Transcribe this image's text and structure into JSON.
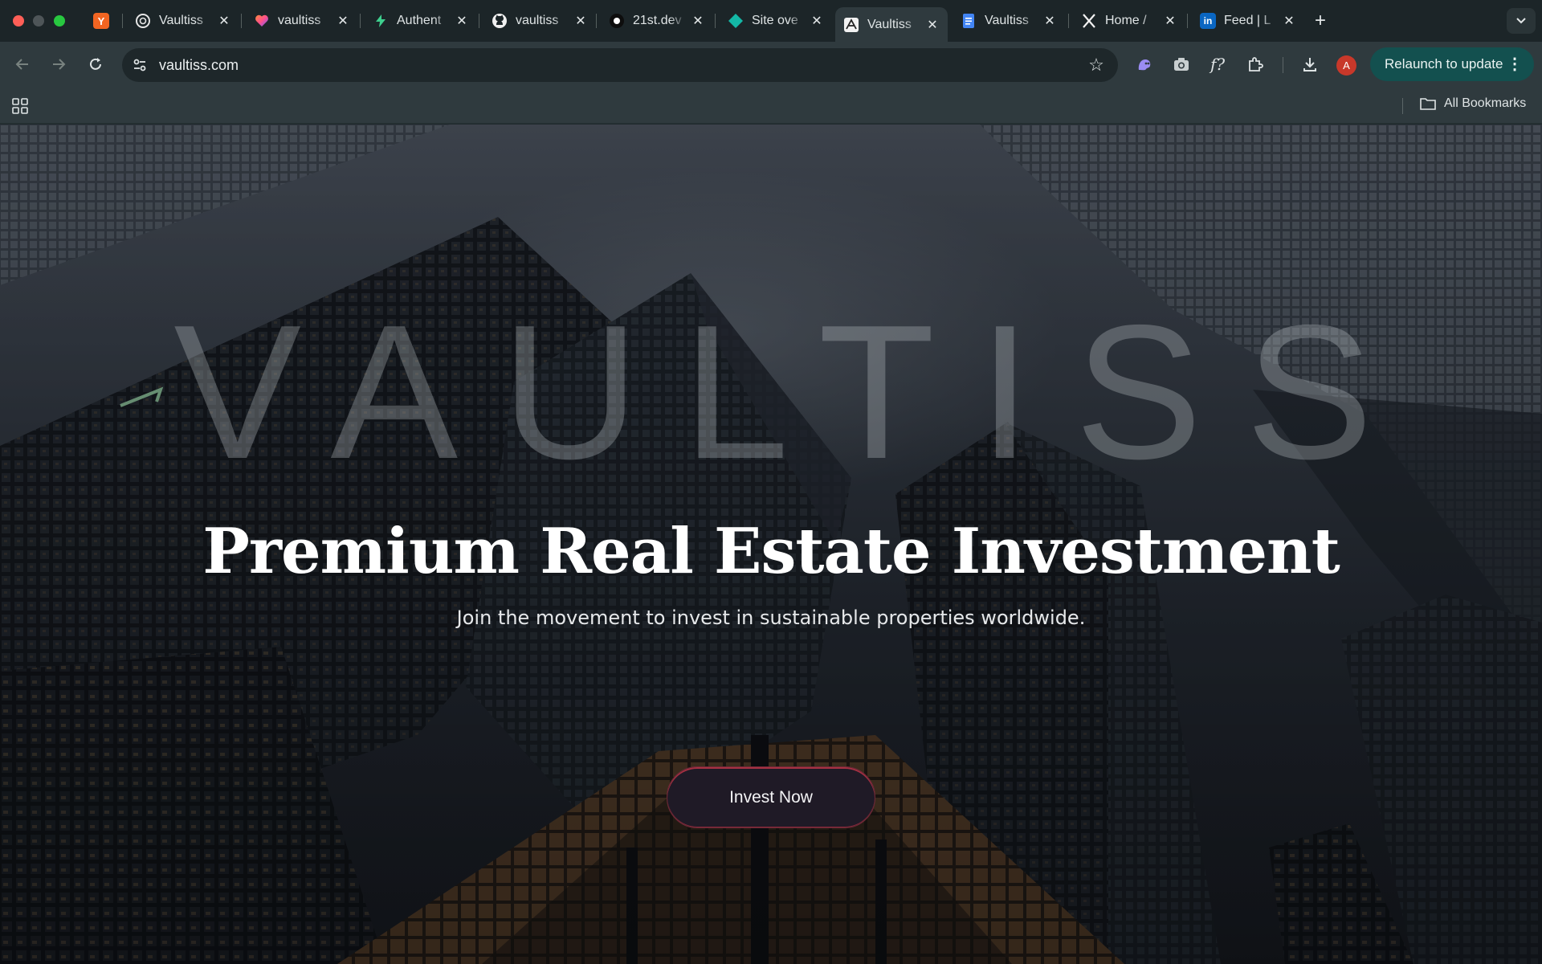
{
  "browser": {
    "tabs": [
      {
        "title": "",
        "favicon": "Y",
        "favicon_color": "#f26522",
        "icon_name": "ycombinator-favicon"
      },
      {
        "title": "Vaultiss",
        "icon_name": "openai-favicon"
      },
      {
        "title": "vaultiss",
        "icon_name": "heart-favicon"
      },
      {
        "title": "Authent",
        "icon_name": "bolt-favicon"
      },
      {
        "title": "vaultiss",
        "icon_name": "github-favicon"
      },
      {
        "title": "21st.dev",
        "icon_name": "dot-favicon"
      },
      {
        "title": "Site ove",
        "icon_name": "diamond-favicon"
      },
      {
        "title": "Vaultiss",
        "icon_name": "vaultiss-favicon",
        "active": true
      },
      {
        "title": "Vaultiss",
        "icon_name": "docs-favicon"
      },
      {
        "title": "Home /",
        "icon_name": "x-favicon"
      },
      {
        "title": "Feed | L",
        "icon_name": "linkedin-favicon"
      }
    ],
    "url": "vaultiss.com",
    "relaunch_label": "Relaunch to update",
    "avatar_letter": "A",
    "all_bookmarks_label": "All Bookmarks"
  },
  "hero": {
    "watermark": "VAULTISS",
    "title": "Premium Real Estate Investment",
    "subtitle": "Join the movement to invest in sustainable properties worldwide.",
    "cta_label": "Invest Now"
  },
  "colors": {
    "tab_strip": "#1c2528",
    "toolbar": "#2f3a3e",
    "relaunch_bg": "#13504f",
    "cta_border": "#a63042"
  }
}
